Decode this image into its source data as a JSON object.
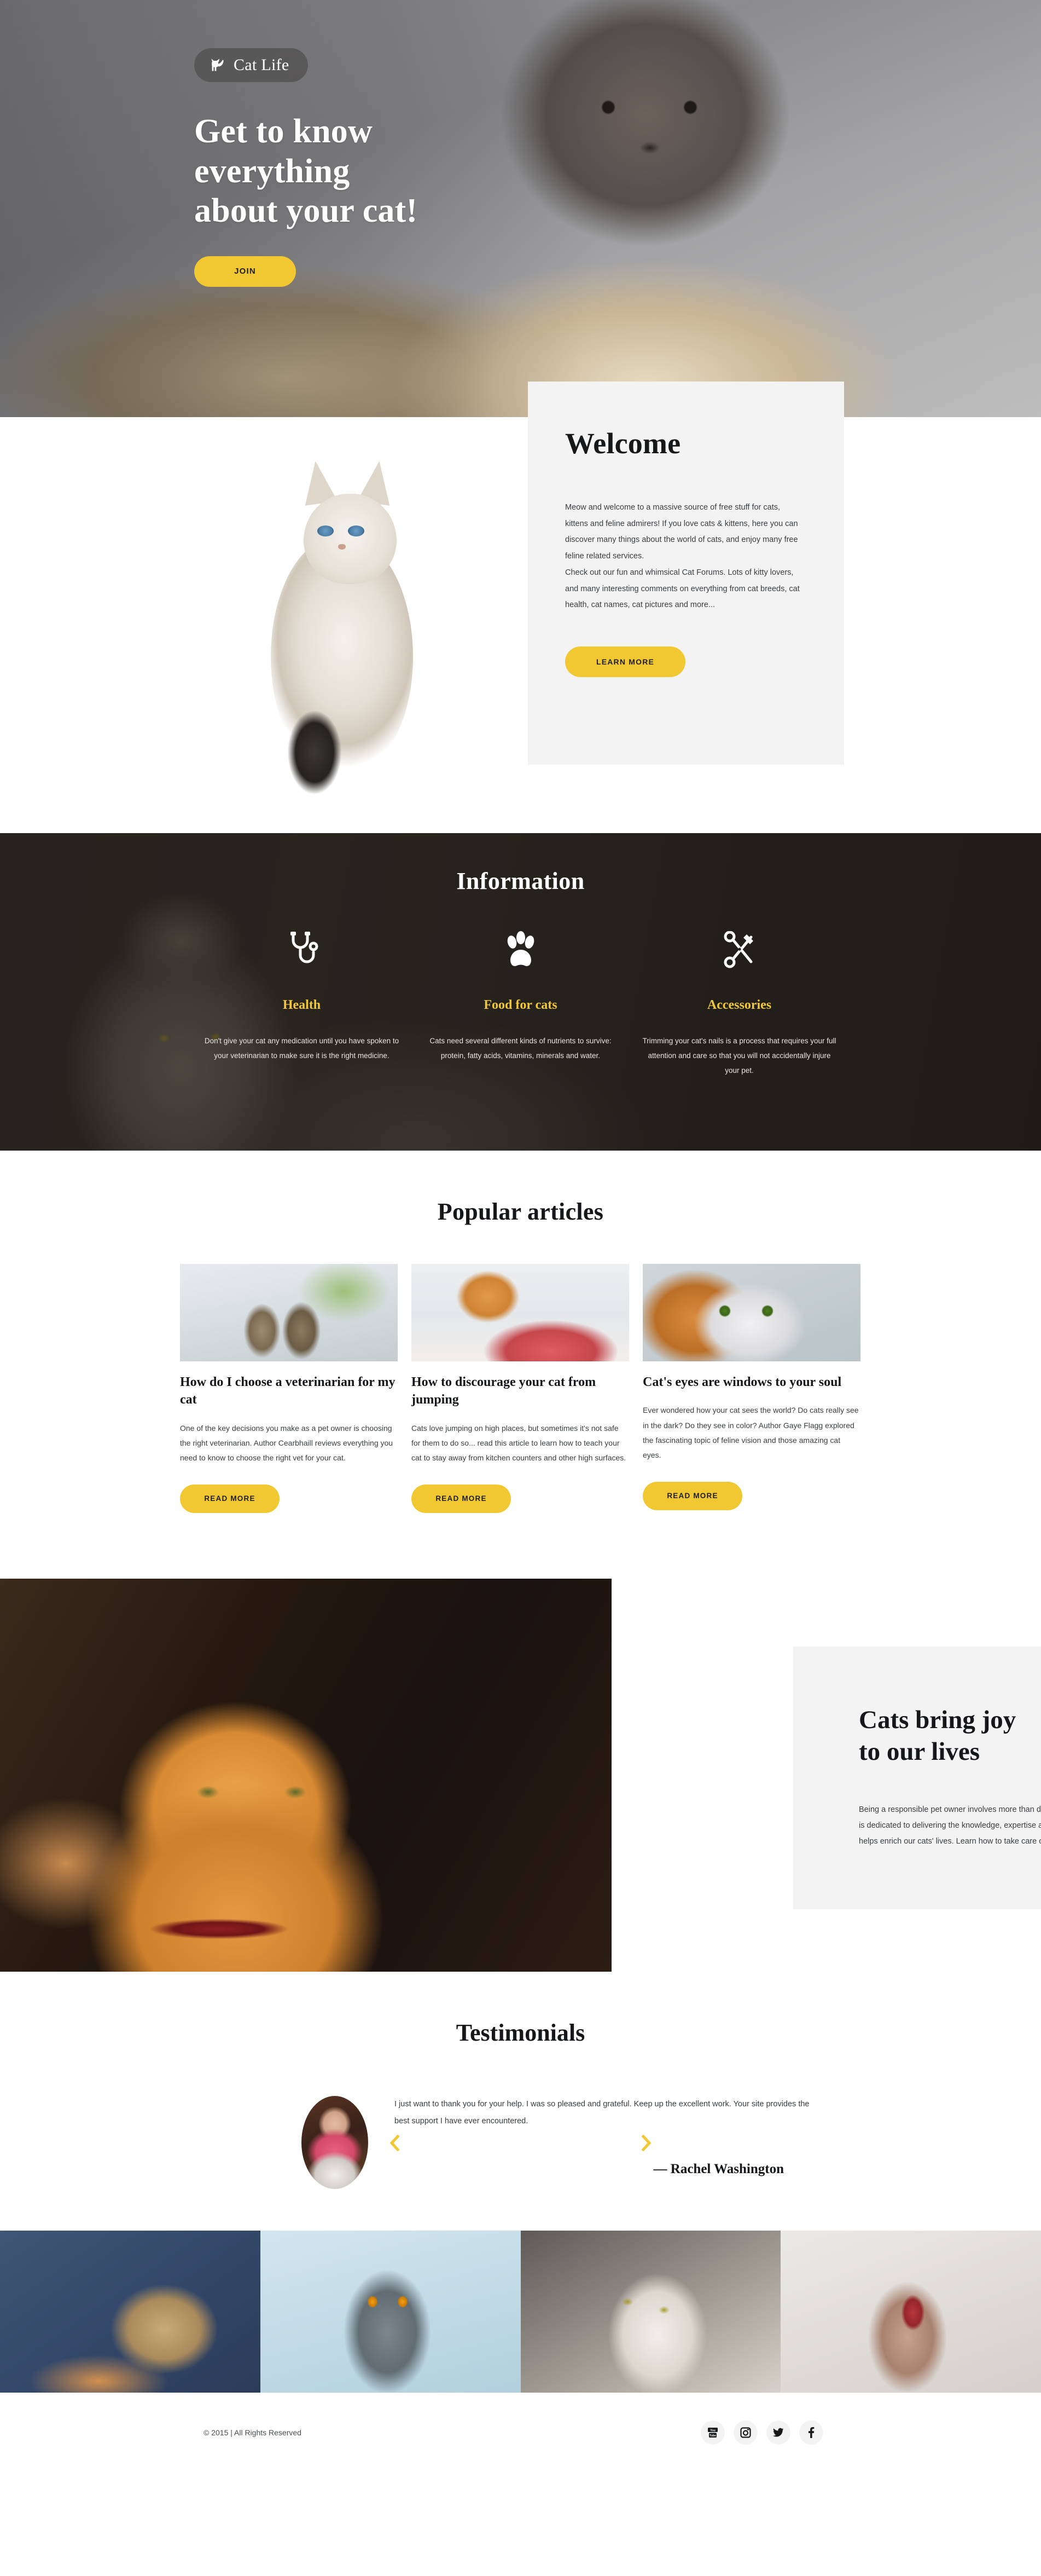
{
  "hero": {
    "logo_text": "Cat Life",
    "logo_icon": "cat-icon",
    "title_line1": "Get to know",
    "title_line2": "everything",
    "title_line3": "about your cat!",
    "cta_label": "JOIN"
  },
  "welcome": {
    "title": "Welcome",
    "paragraph1": "Meow and welcome to a massive source of free stuff for cats, kittens and feline admirers! If you love cats & kittens, here you can discover many things about the world of cats, and enjoy many free feline related services.",
    "paragraph2": "Check out our fun and whimsical Cat Forums. Lots of kitty lovers, and many interesting comments on everything from cat breeds, cat health, cat names, cat pictures and more...",
    "cta_label": "LEARN MORE"
  },
  "information": {
    "title": "Information",
    "items": [
      {
        "icon": "stethoscope-icon",
        "name": "Health",
        "description": "Don't give your cat any medication until you have spoken to your veterinarian to make sure it is the right medicine."
      },
      {
        "icon": "paw-print-icon",
        "name": "Food for cats",
        "description": "Cats need several different kinds of nutrients to survive: protein, fatty acids, vitamins, minerals and water."
      },
      {
        "icon": "scissors-icon",
        "name": "Accessories",
        "description": "Trimming your cat's nails is a process that requires your full attention and care so that you will not accidentally injure your pet."
      }
    ]
  },
  "articles": {
    "title": "Popular articles",
    "items": [
      {
        "image": "two-kittens-on-windowsill",
        "title": "How do I choose a veterinarian for my cat",
        "text": "One of the key decisions you make as a pet owner is choosing the right veterinarian. Author Cearbhaill reviews everything you need to know to choose the right vet for your cat.",
        "cta_label": "READ MORE"
      },
      {
        "image": "ginger-cat-looking-at-meat",
        "title": "How to discourage your cat from jumping",
        "text": "Cats love jumping on high places, but sometimes it's not safe for them to do so... read this article to learn how to teach your cat to stay away from kitchen counters and other high surfaces.",
        "cta_label": "READ MORE"
      },
      {
        "image": "close-up-of-cat-eyes",
        "title": "Cat's eyes are windows to your soul",
        "text": "Ever wondered how your cat sees the world? Do cats really see in the dark? Do they see in color? Author Gaye Flagg explored the fascinating topic of feline vision and those amazing cat eyes.",
        "cta_label": "READ MORE"
      }
    ]
  },
  "joy": {
    "image": "ginger-cat-with-red-collar",
    "title_line1": "Cats bring joy",
    "title_line2": "to our lives",
    "text": "Being a responsible pet owner involves more than devotion and love. That's why Cat Life is dedicated to delivering the knowledge, expertise and state-of-the-art science that helps enrich our cats' lives. Learn how to take care of a cat here."
  },
  "testimonials": {
    "title": "Testimonials",
    "prev_icon": "chevron-left-icon",
    "next_icon": "chevron-right-icon",
    "current": {
      "avatar": "woman-holding-cat",
      "text": "I just want to thank you for your help. I was so pleased and grateful. Keep up the excellent work. Your site provides the best support I have ever encountered.",
      "author": "— Rachel Washington"
    }
  },
  "gallery": {
    "images": [
      "sleepy-tabby-kitten-on-blue",
      "grey-cat-with-orange-eyes",
      "grey-and-white-fluffy-cat",
      "hairless-sphynx-cat-meowing"
    ]
  },
  "footer": {
    "copyright": "© 2015 | All Rights Reserved",
    "socials": [
      {
        "name": "youtube-icon",
        "label": "YouTube"
      },
      {
        "name": "instagram-icon",
        "label": "Instagram"
      },
      {
        "name": "twitter-icon",
        "label": "Twitter"
      },
      {
        "name": "facebook-icon",
        "label": "Facebook"
      }
    ]
  },
  "colors": {
    "accent_yellow": "#f1c732",
    "info_accent": "#f0c83a",
    "dark_text": "#15171a",
    "body_text": "#3a3d40",
    "card_bg": "#f3f3f3"
  }
}
